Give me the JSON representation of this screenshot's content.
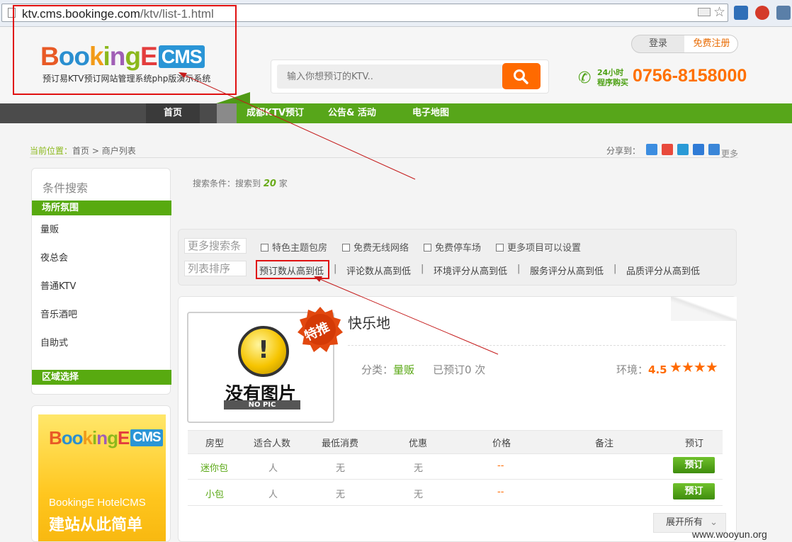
{
  "browser": {
    "url_host": "ktv.cms.bookinge.com",
    "url_path": "/ktv/list-1.html"
  },
  "header": {
    "logo_sub": "预订易KTV预订网站管理系统php版演示系统",
    "search_placeholder": "输入你想预订的KTV..",
    "login": "登录",
    "register": "免费注册",
    "hotline_line1": "24小时",
    "hotline_line2": "程序购买",
    "phone": "0756-8158000"
  },
  "nav": {
    "items": [
      "首页",
      "成都KTV预订",
      "公告& 活动",
      "电子地图"
    ]
  },
  "breadcrumb": {
    "label": "当前位置：",
    "home": "首页",
    "sep": ">",
    "current": "商户列表",
    "share": "分享到：",
    "more": "更多"
  },
  "sidebar": {
    "title": "条件搜索",
    "group1": "场所氛围",
    "items": [
      "量贩",
      "夜总会",
      "普通KTV",
      "音乐酒吧",
      "自助式"
    ],
    "group2": "区域选择",
    "banner_text1": "BookingE HotelCMS",
    "banner_text2": "建站从此简单"
  },
  "results": {
    "prefix": "搜索条件：搜索到",
    "count": "20",
    "suffix": "家"
  },
  "filters": {
    "more_label": "更多搜索条",
    "options": [
      "特色主题包房",
      "免费无线网络",
      "免费停车场",
      "更多项目可以设置"
    ],
    "sort_label": "列表排序",
    "sorts": [
      "预订数从高到低",
      "评论数从高到低",
      "环境评分从高到低",
      "服务评分从高到低",
      "品质评分从高到低"
    ]
  },
  "card": {
    "badge": "特推",
    "no_pic": "没有图片",
    "no_pic_en": "NO PIC",
    "name": "快乐地",
    "category_label": "分类：",
    "category": "量贩",
    "booked": "已预订0 次",
    "env_label": "环境：",
    "env_score": "4.5",
    "rating": 4.5,
    "columns": [
      "房型",
      "适合人数",
      "最低消费",
      "优惠",
      "价格",
      "备注",
      "预订"
    ],
    "rows": [
      {
        "type": "迷你包",
        "people": "人",
        "min": "无",
        "discount": "无",
        "price": "--",
        "book": "预订"
      },
      {
        "type": "小包",
        "people": "人",
        "min": "无",
        "discount": "无",
        "price": "--",
        "book": "预订"
      }
    ],
    "expand": "展开所有"
  },
  "watermark": "www.wooyun.org"
}
